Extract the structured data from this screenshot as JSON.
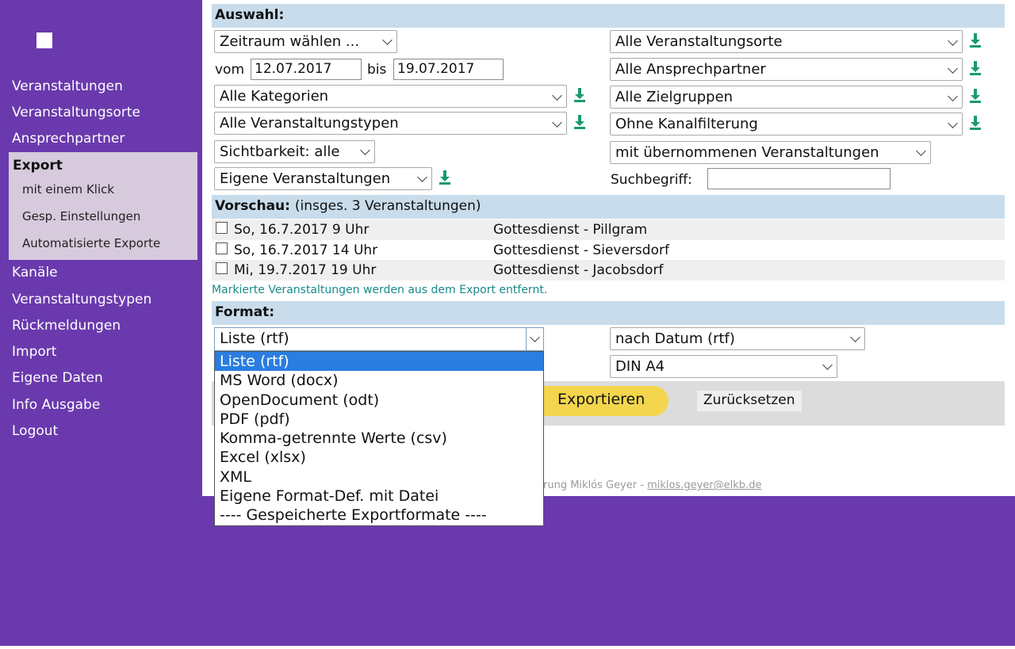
{
  "sidebar": {
    "nav_top": [
      "Veranstaltungen",
      "Veranstaltungsorte",
      "Ansprechpartner"
    ],
    "export": {
      "title": "Export",
      "items": [
        "mit einem Klick",
        "Gesp. Einstellungen",
        "Automatisierte Exporte"
      ]
    },
    "nav_bottom": [
      "Kanäle",
      "Veranstaltungstypen",
      "Rückmeldungen",
      "Import",
      "Eigene Daten",
      "Info Ausgabe",
      "Logout"
    ]
  },
  "auswahl": {
    "heading": "Auswahl:",
    "zeitraum": "Zeitraum wählen ...",
    "vom_label": "vom",
    "vom_value": "12.07.2017",
    "bis_label": "bis",
    "bis_value": "19.07.2017",
    "kategorien": "Alle Kategorien",
    "typen": "Alle Veranstaltungstypen",
    "sichtbarkeit": "Sichtbarkeit: alle",
    "eigene": "Eigene Veranstaltungen",
    "orte": "Alle Veranstaltungsorte",
    "ansprechpartner": "Alle Ansprechpartner",
    "zielgruppen": "Alle Zielgruppen",
    "kanal": "Ohne Kanalfilterung",
    "uebernommen": "mit übernommenen Veranstaltungen",
    "suchbegriff_label": "Suchbegriff:",
    "suchbegriff_value": ""
  },
  "vorschau": {
    "heading": "Vorschau:",
    "count_text": "(insges. 3 Veranstaltungen)",
    "events": [
      {
        "date": "So, 16.7.2017 9 Uhr",
        "name": "Gottesdienst - Pillgram"
      },
      {
        "date": "So, 16.7.2017 14 Uhr",
        "name": "Gottesdienst - Sieversdorf"
      },
      {
        "date": "Mi, 19.7.2017 19 Uhr",
        "name": "Gottesdienst - Jacobsdorf"
      }
    ],
    "note": "Markierte Veranstaltungen werden aus dem Export entfernt."
  },
  "format": {
    "heading": "Format:",
    "selected": "Liste (rtf)",
    "options": [
      "Liste (rtf)",
      "MS Word (docx)",
      "OpenDocument (odt)",
      "PDF (pdf)",
      "Komma-getrennte Werte (csv)",
      "Excel (xlsx)",
      "XML",
      "Eigene Format-Def. mit Datei",
      "---- Gespeicherte Exportformate ----"
    ],
    "sortierung": "nach Datum (rtf)",
    "papier": "DIN A4"
  },
  "actions": {
    "export_label": "Exportieren",
    "reset_label": "Zurücksetzen"
  },
  "footer": {
    "text": "rung Miklós Geyer - ",
    "link": "miklos.geyer@elkb.de"
  },
  "colors": {
    "sidebar_bg": "#6a39ad",
    "section_header_bg": "#c8dceb",
    "download_icon": "#1a9a6a",
    "export_button": "#f3d64d",
    "dropdown_selected": "#2a7de1"
  }
}
